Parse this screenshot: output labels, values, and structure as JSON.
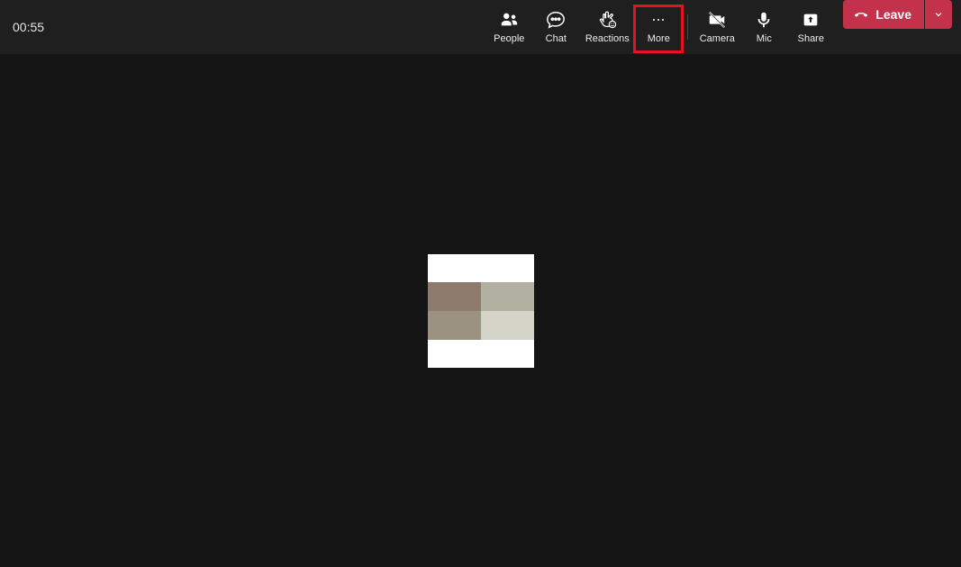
{
  "call": {
    "timer": "00:55"
  },
  "toolbar": {
    "people": "People",
    "chat": "Chat",
    "reactions": "Reactions",
    "more": "More",
    "camera": "Camera",
    "mic": "Mic",
    "share": "Share"
  },
  "leave": {
    "label": "Leave"
  },
  "highlight": {
    "target": "more"
  },
  "avatar": {
    "colors": {
      "top_left": "#8f7b6d",
      "top_right": "#b1b0a1",
      "bottom_left": "#9c9282",
      "bottom_right": "#d4d3c7"
    }
  }
}
